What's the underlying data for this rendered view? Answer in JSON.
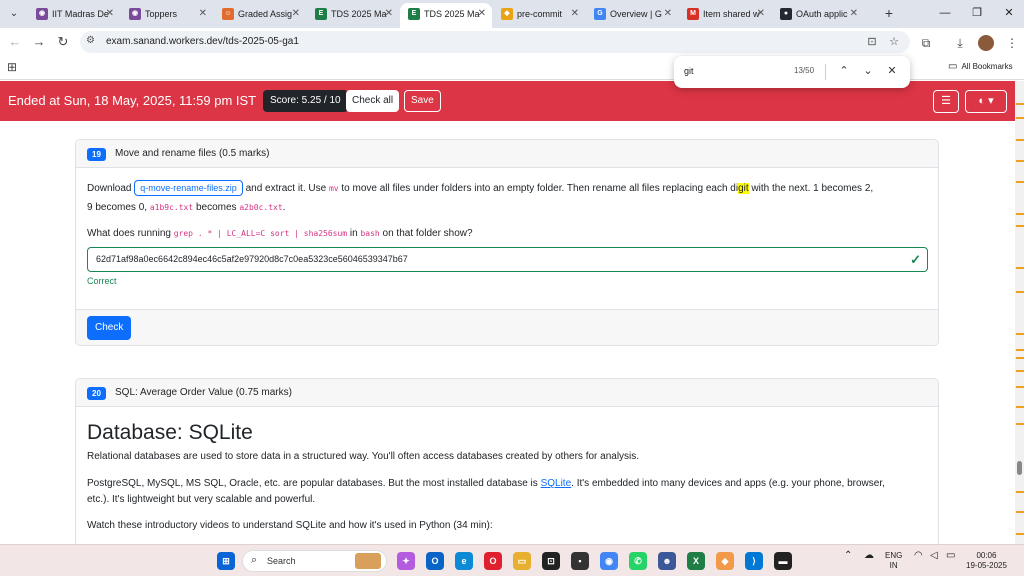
{
  "browser": {
    "tabs": [
      {
        "label": "IIT Madras De",
        "color": "#7a4b9b",
        "glyph": "◉"
      },
      {
        "label": "Toppers",
        "color": "#7a4b9b",
        "glyph": "◉"
      },
      {
        "label": "Graded Assig",
        "color": "#e06c2f",
        "glyph": "☺"
      },
      {
        "label": "TDS 2025 Ma",
        "color": "#1e7e45",
        "glyph": "E"
      },
      {
        "label": "TDS 2025 Ma",
        "color": "#1e7e45",
        "glyph": "E",
        "active": true
      },
      {
        "label": "pre-commit",
        "color": "#e8a317",
        "glyph": "◆"
      },
      {
        "label": "Overview | G",
        "color": "#4285f4",
        "glyph": "G"
      },
      {
        "label": "Item shared w",
        "color": "#d93025",
        "glyph": "M"
      },
      {
        "label": "OAuth applic",
        "color": "#24292f",
        "glyph": "●"
      }
    ],
    "url": "exam.sanand.workers.dev/tds-2025-05-ga1",
    "bookmarks_label": "All Bookmarks",
    "find": {
      "query": "git",
      "count": "13/50"
    }
  },
  "header": {
    "ended_text": "Ended at Sun, 18 May, 2025, 11:59 pm IST",
    "score": "Score: 5.25 / 10",
    "check_all": "Check all",
    "save": "Save"
  },
  "q19": {
    "number": "19",
    "title": "Move and rename files (0.5 marks)",
    "download_word": "Download",
    "file_button": "q-move-rename-files.zip",
    "line1_a": "and extract it. Use",
    "mv": "mv",
    "line1_b": "to move all files under folders into an empty folder. Then rename all files replacing each di",
    "highlight": "git",
    "line1_c": "with the next. 1 becomes 2,",
    "line2_a": "9 becomes 0,",
    "code_a": "a1b9c.txt",
    "line2_b": "becomes",
    "code_b": "a2b0c.txt",
    "line2_c": ".",
    "q_a": "What does running",
    "q_cmd": "grep . * | LC_ALL=C sort | sha256sum",
    "q_b": "in",
    "q_bash": "bash",
    "q_c": "on that folder show?",
    "answer": "62d71af98a0ec6642c894ec46c5af2e97920d8c7c0ea5323ce56046539347b67",
    "status": "Correct",
    "check": "Check"
  },
  "q20": {
    "number": "20",
    "title": "SQL: Average Order Value (0.75 marks)",
    "heading": "Database: SQLite",
    "p1": "Relational databases are used to store data in a structured way. You'll often access databases created by others for analysis.",
    "p2_a": "PostgreSQL, MySQL, MS SQL, Oracle, etc. are popular databases. But the most installed database is",
    "p2_link": "SQLite",
    "p2_b": ". It's embedded into many devices and apps (e.g. your phone, browser,",
    "p2_c": "etc.). It's lightweight but very scalable and powerful.",
    "p3": "Watch these introductory videos to understand SQLite and how it's used in Python (34 min):"
  },
  "taskbar": {
    "search": "Search",
    "lang_top": "ENG",
    "lang_bottom": "IN",
    "time": "00:06",
    "date": "19-05-2025"
  },
  "colors": {
    "header_red": "#dc3545",
    "primary": "#0d6efd",
    "success": "#198754"
  }
}
